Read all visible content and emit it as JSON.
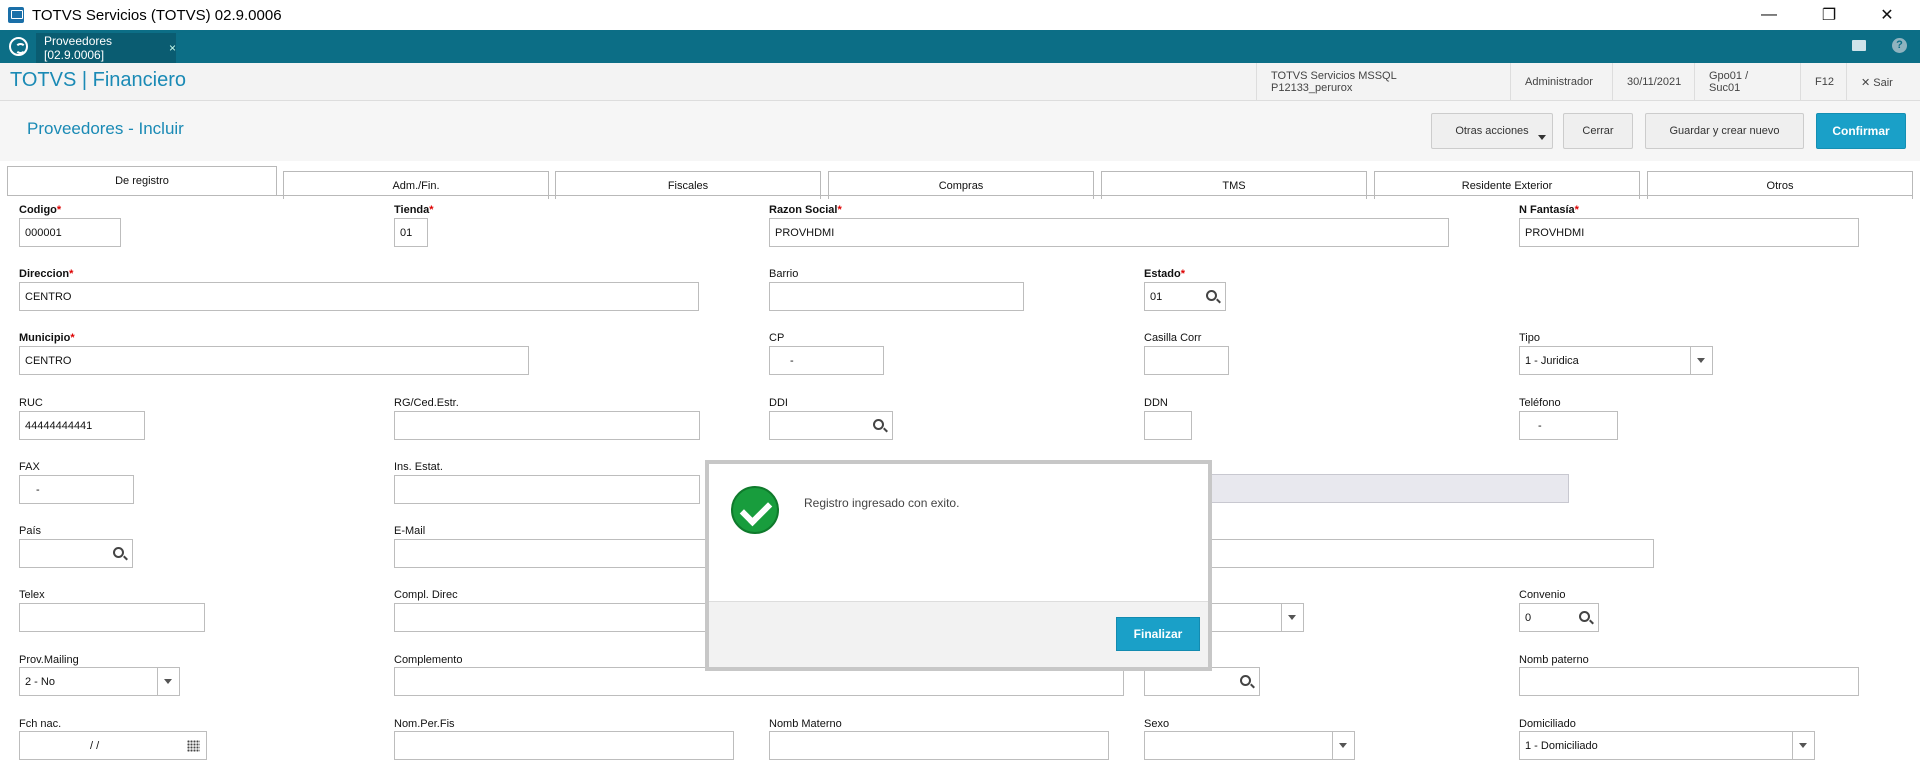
{
  "window": {
    "title": "TOTVS Servicios (TOTVS) 02.9.0006",
    "controls": {
      "minimize": "—",
      "restore": "❐",
      "close": "✕"
    }
  },
  "tabbar": {
    "tab_label": "Proveedores [02.9.0006]",
    "tab_close": "×",
    "help": "?"
  },
  "module_header": {
    "brand": "TOTVS | Financiero",
    "environment": "TOTVS Servicios MSSQL P12133_perurox",
    "user": "Administrador",
    "date": "30/11/2021",
    "branch": "Gpo01 / Suc01",
    "shortcut": "F12",
    "exit": "✕ Sair"
  },
  "page": {
    "title": "Proveedores - Incluir",
    "buttons": {
      "other_actions": "Otras acciones",
      "close": "Cerrar",
      "save_new": "Guardar y crear nuevo",
      "confirm": "Confirmar"
    }
  },
  "form_tabs": [
    "De registro",
    "Adm./Fin.",
    "Fiscales",
    "Compras",
    "TMS",
    "Residente Exterior",
    "Otros"
  ],
  "fields": {
    "codigo": {
      "label": "Codigo",
      "value": "000001"
    },
    "tienda": {
      "label": "Tienda",
      "value": "01"
    },
    "razon_social": {
      "label": "Razon Social",
      "value": "PROVHDMI"
    },
    "n_fantasia": {
      "label": "N Fantasía",
      "value": "PROVHDMI"
    },
    "direccion": {
      "label": "Direccion",
      "value": "CENTRO"
    },
    "barrio": {
      "label": "Barrio",
      "value": ""
    },
    "estado": {
      "label": "Estado",
      "value": "01"
    },
    "municipio": {
      "label": "Municipio",
      "value": "CENTRO"
    },
    "cp": {
      "label": "CP",
      "value": "-"
    },
    "casilla_corr": {
      "label": "Casilla Corr",
      "value": ""
    },
    "tipo": {
      "label": "Tipo",
      "value": "1 - Juridica"
    },
    "ruc": {
      "label": "RUC",
      "value": "44444444441"
    },
    "rg_ced": {
      "label": "RG/Ced.Estr.",
      "value": ""
    },
    "ddi": {
      "label": "DDI",
      "value": ""
    },
    "ddn": {
      "label": "DDN",
      "value": ""
    },
    "telefono": {
      "label": "Teléfono",
      "value": "-"
    },
    "fax": {
      "label": "FAX",
      "value": "-"
    },
    "ins_estat": {
      "label": "Ins. Estat.",
      "value": ""
    },
    "pais": {
      "label": "País",
      "value": ""
    },
    "email": {
      "label": "E-Mail",
      "value": ""
    },
    "telex": {
      "label": "Telex",
      "value": ""
    },
    "compl_direc": {
      "label": "Compl. Direc",
      "value": ""
    },
    "convenio": {
      "label": "Convenio",
      "value": "0"
    },
    "prov_mailing": {
      "label": "Prov.Mailing",
      "value": "2 - No"
    },
    "complemento": {
      "label": "Complemento",
      "value": ""
    },
    "nomb_paterno": {
      "label": "Nomb paterno",
      "value": ""
    },
    "fch_nac": {
      "label": "Fch nac.",
      "value": "/ /"
    },
    "nom_per_fis": {
      "label": "Nom.Per.Fis",
      "value": ""
    },
    "nomb_materno": {
      "label": "Nomb Materno",
      "value": ""
    },
    "sexo": {
      "label": "Sexo",
      "value": ""
    },
    "domiciliado": {
      "label": "Domiciliado",
      "value": "1 - Domiciliado"
    }
  },
  "required_marker": "*",
  "modal": {
    "message": "Registro ingresado con exito.",
    "finish_button": "Finalizar"
  },
  "colors": {
    "tabbar": "#0c6e86",
    "accent": "#1aa0c8",
    "success": "#189d3d",
    "required": "#dd0000"
  }
}
